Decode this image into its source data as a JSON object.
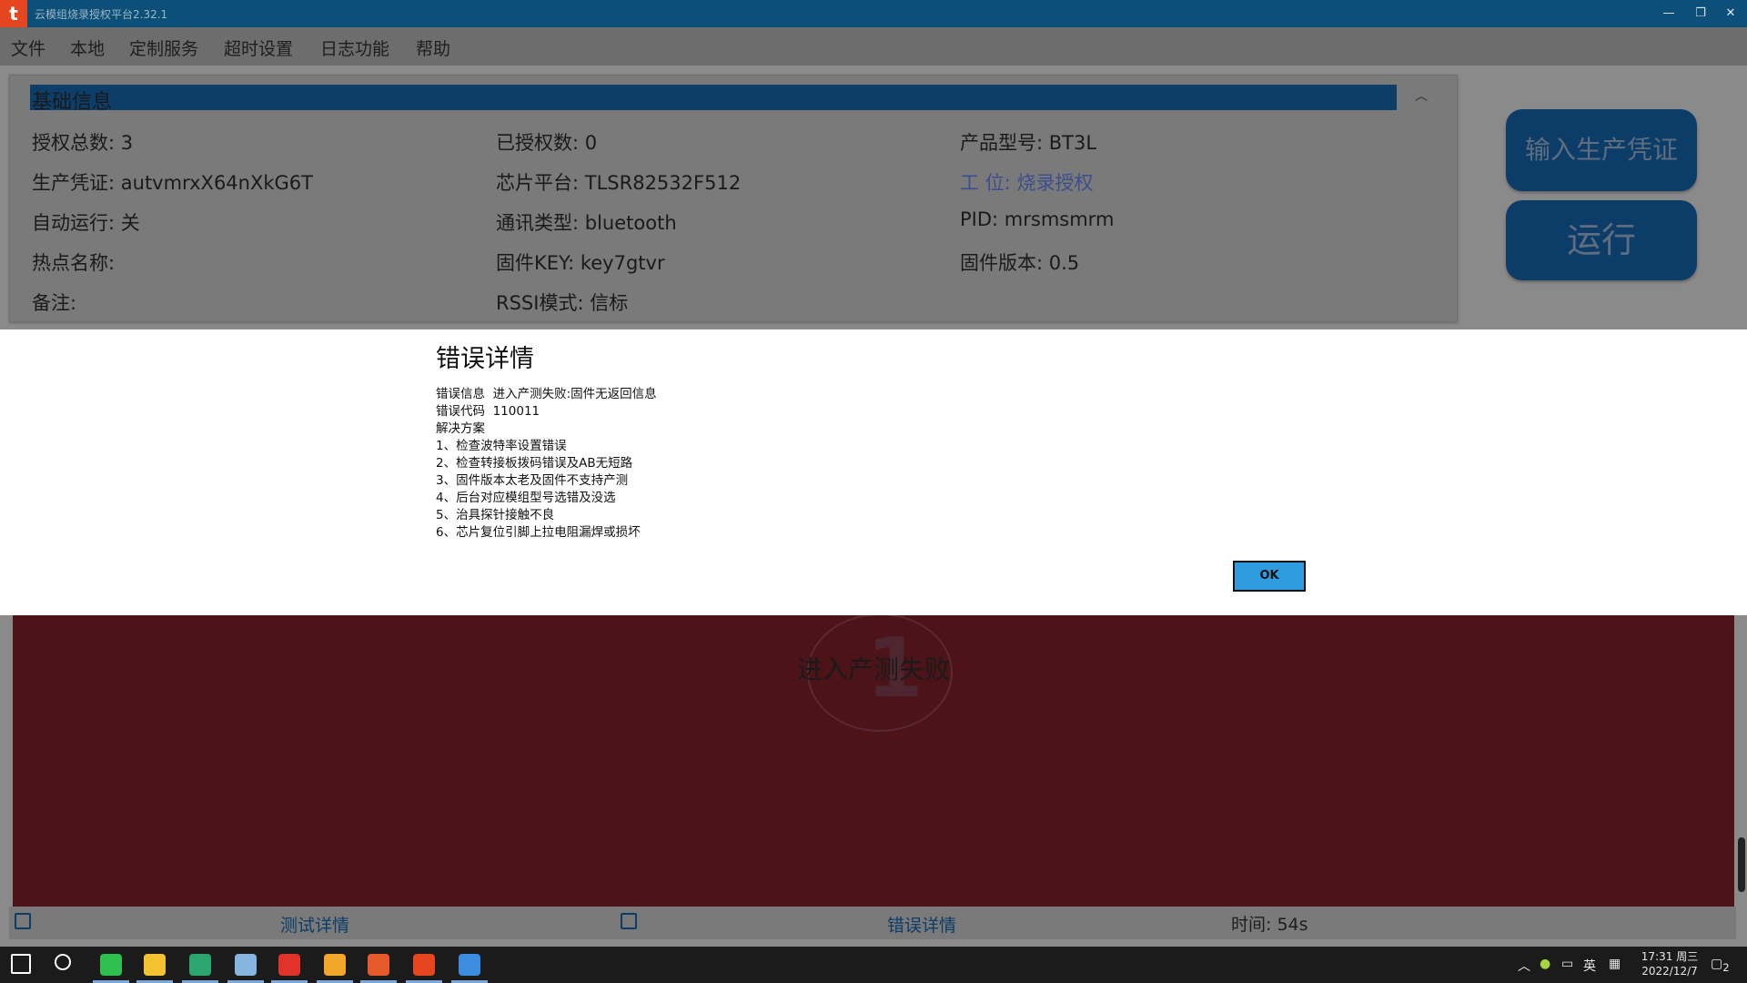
{
  "window": {
    "title": "云模组烧录授权平台2.32.1",
    "logo": "t"
  },
  "menu": [
    "文件",
    "本地",
    "定制服务",
    "超时设置",
    "日志功能",
    "帮助"
  ],
  "info": {
    "header": "基础信息",
    "fields": [
      {
        "label": "授权总数:",
        "value": "3"
      },
      {
        "label": "已授权数:",
        "value": "0"
      },
      {
        "label": "产品型号:",
        "value": "BT3L"
      },
      {
        "label": "生产凭证:",
        "value": "autvmrxX64nXkG6T"
      },
      {
        "label": "芯片平台:",
        "value": "TLSR82532F512"
      },
      {
        "label": "工 位:",
        "value": "烧录授权"
      },
      {
        "label": "自动运行:",
        "value": "关"
      },
      {
        "label": "通讯类型:",
        "value": "bluetooth"
      },
      {
        "label": "PID:",
        "value": "mrsmsmrm"
      },
      {
        "label": "热点名称:",
        "value": ""
      },
      {
        "label": "固件KEY:",
        "value": "key7gtvr"
      },
      {
        "label": "固件版本:",
        "value": "0.5"
      },
      {
        "label": "备注:",
        "value": ""
      },
      {
        "label": "RSSI模式:",
        "value": "信标"
      }
    ]
  },
  "buttons": {
    "input_credential": "输入生产凭证",
    "run": "运行"
  },
  "result": {
    "digit": "1",
    "text": "进入产测失败"
  },
  "status": {
    "test_detail": "测试详情",
    "error_detail": "错误详情",
    "time_label": "时间:",
    "time_value": "54s"
  },
  "dialog": {
    "title": "错误详情",
    "error_info_label": "错误信息",
    "error_info": "进入产测失败:固件无返回信息",
    "error_code_label": "错误代码",
    "error_code": "110011",
    "solution_label": "解决方案",
    "solutions": [
      "1、检查波特率设置错误",
      "2、检查转接板拨码错误及AB无短路",
      "3、固件版本太老及固件不支持产测",
      "4、后台对应模组型号选错及没选",
      "5、治具探针接触不良",
      "6、芯片复位引脚上拉电阻漏焊或损坏"
    ],
    "ok": "OK"
  },
  "taskbar": {
    "ime": "英",
    "time": "17:31 周三",
    "date": "2022/12/7",
    "notifications": "2",
    "icons": [
      "windows-start-icon",
      "search-icon",
      "wechat-icon",
      "file-explorer-icon",
      "code-app-icon",
      "notes-icon",
      "wps-icon",
      "files-icon",
      "pdf-icon",
      "tuya-icon",
      "chrome-icon"
    ],
    "icon_colors": [
      "#ffffff",
      "#ffffff",
      "#2fbf4f",
      "#f2c230",
      "#2aa66e",
      "#86b6e0",
      "#e2332b",
      "#f2a629",
      "#e65a2b",
      "#e5451f",
      "#3c8de0"
    ]
  }
}
